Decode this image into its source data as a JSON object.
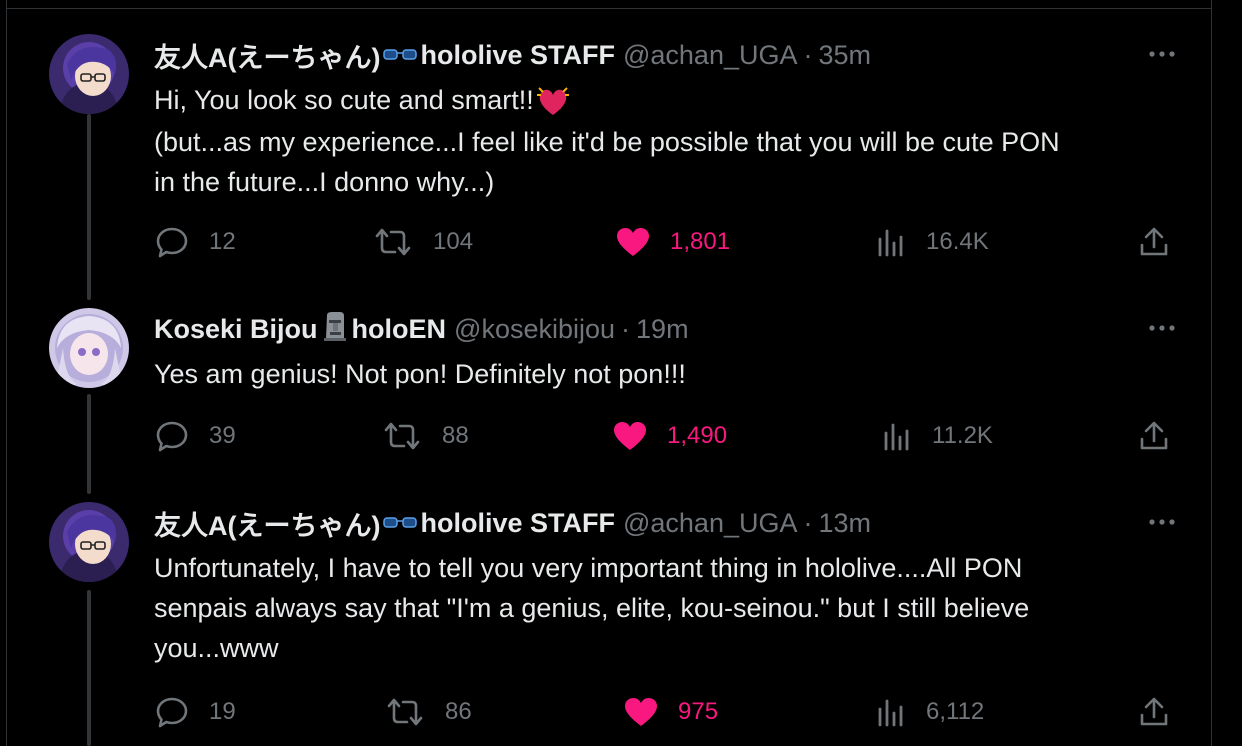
{
  "tweets": [
    {
      "display_name": "友人A(えーちゃん)",
      "name_suffix": "hololive STAFF",
      "name_emoji": "glasses-icon",
      "handle": "@achan_UGA",
      "dot": "·",
      "time": "35m",
      "text_lines": [
        "Hi, You look so cute and smart!!",
        "(but...as my experience...I feel like it'd be possible that you will be cute PON",
        "in the future...I donno why...)"
      ],
      "text_emoji": "beating-heart-icon",
      "replies": "12",
      "retweets": "104",
      "likes": "1,801",
      "views": "16.4K"
    },
    {
      "display_name": "Koseki Bijou",
      "name_suffix": "holoEN",
      "name_emoji": "moai-icon",
      "handle": "@kosekibijou",
      "dot": "·",
      "time": "19m",
      "text_lines": [
        "Yes am genius! Not pon! Definitely not pon!!!"
      ],
      "replies": "39",
      "retweets": "88",
      "likes": "1,490",
      "views": "11.2K"
    },
    {
      "display_name": "友人A(えーちゃん)",
      "name_suffix": "hololive STAFF",
      "name_emoji": "glasses-icon",
      "handle": "@achan_UGA",
      "dot": "·",
      "time": "13m",
      "text_lines": [
        "Unfortunately, I have to tell you very important thing in hololive....All PON",
        "senpais always say that \"I'm a genius, elite, kou-seinou.\" but I still believe",
        "you...www"
      ],
      "replies": "19",
      "retweets": "86",
      "likes": "975",
      "views": "6,112"
    }
  ],
  "colors": {
    "background": "#000000",
    "text": "#e7e9ea",
    "muted": "#71767b",
    "like_pink": "#f91880",
    "border": "#2f3336"
  }
}
